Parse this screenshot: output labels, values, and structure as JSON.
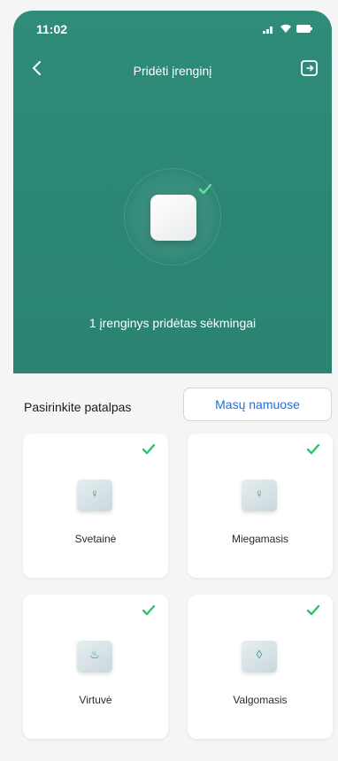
{
  "status_bar": {
    "time": "11:02"
  },
  "header": {
    "title": "Pridėti įrenginį"
  },
  "hero": {
    "success_message": "1 įrenginys pridėtas sėkmingai"
  },
  "room_select": {
    "label": "Pasirinkite patalpas",
    "home_button": "Masų namuose"
  },
  "rooms": [
    {
      "name": "Svetainė",
      "icon": "living-room-icon",
      "selected": true
    },
    {
      "name": "Miegamasis",
      "icon": "bedroom-icon",
      "selected": true
    },
    {
      "name": "Virtuvė",
      "icon": "kitchen-icon",
      "selected": true
    },
    {
      "name": "Valgomasis",
      "icon": "dining-room-icon",
      "selected": true
    }
  ],
  "colors": {
    "hero_bg": "#2c8674",
    "accent_blue": "#1e6fd9",
    "check_green": "#2cc46b",
    "page_bg": "#f4f5f5"
  }
}
